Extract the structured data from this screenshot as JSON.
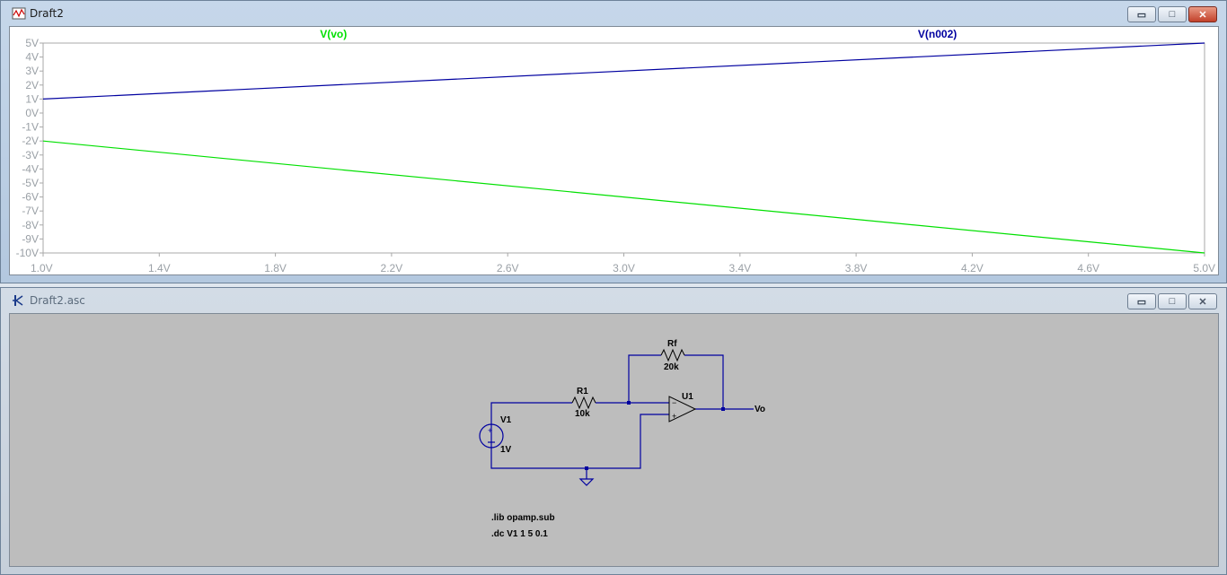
{
  "plot_window": {
    "title": "Draft2"
  },
  "schematic_window": {
    "title": "Draft2.asc",
    "components": {
      "R1": {
        "name": "R1",
        "value": "10k"
      },
      "Rf": {
        "name": "Rf",
        "value": "20k"
      },
      "U1": {
        "name": "U1"
      },
      "V1": {
        "name": "V1",
        "value": "1V"
      },
      "net_label": "Vo"
    },
    "directives": [
      ".lib opamp.sub",
      ".dc V1 1 5 0.1"
    ]
  },
  "window_buttons": {
    "minimize": "▭",
    "maximize": "□",
    "close": "✕"
  },
  "colors": {
    "vo": "#00e000",
    "n002": "#0000a0",
    "wire": "#0000a0",
    "axis_text": "#9aa0a6"
  },
  "chart_data": {
    "type": "line",
    "x": [
      1.0,
      5.0
    ],
    "xlim": [
      1.0,
      5.0
    ],
    "ylim": [
      -10,
      5
    ],
    "x_ticks": [
      "1.0V",
      "1.4V",
      "1.8V",
      "2.2V",
      "2.6V",
      "3.0V",
      "3.4V",
      "3.8V",
      "4.2V",
      "4.6V",
      "5.0V"
    ],
    "y_ticks": [
      "5V",
      "4V",
      "3V",
      "2V",
      "1V",
      "0V",
      "-1V",
      "-2V",
      "-3V",
      "-4V",
      "-5V",
      "-6V",
      "-7V",
      "-8V",
      "-9V",
      "-10V"
    ],
    "series": [
      {
        "name": "V(vo)",
        "values": [
          -2,
          -10
        ],
        "color": "#00e000"
      },
      {
        "name": "V(n002)",
        "values": [
          1,
          5
        ],
        "color": "#0000a0"
      }
    ]
  }
}
